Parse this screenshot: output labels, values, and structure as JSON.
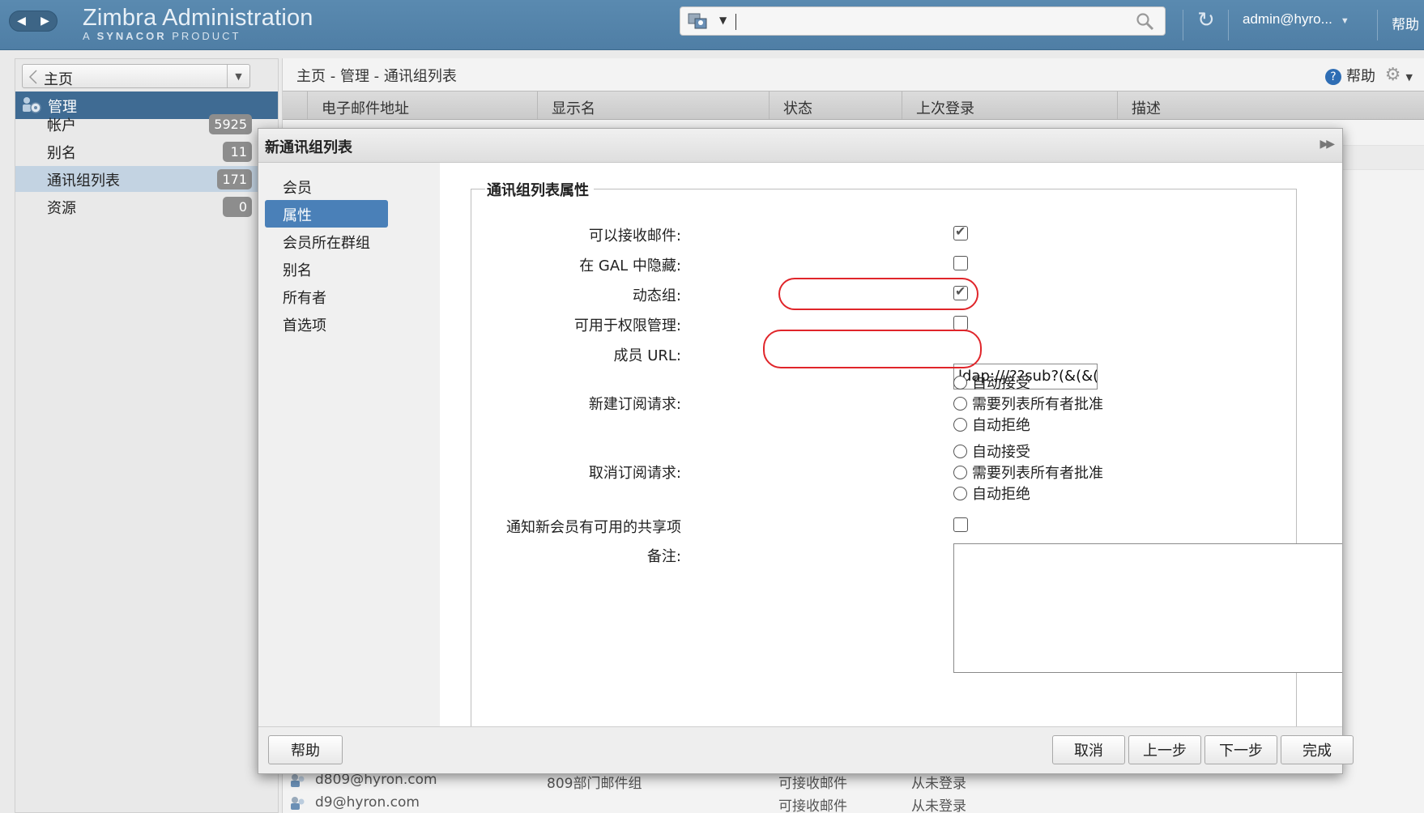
{
  "header": {
    "brand_title": "Zimbra Administration",
    "brand_sub_prefix": "A ",
    "brand_sub_bold": "SYNACOR",
    "brand_sub_suffix": " PRODUCT",
    "search_value": "",
    "user": "admin@hyro...",
    "help": "帮助",
    "icons": [
      "back-arrow-icon",
      "forward-arrow-icon",
      "search-type-icon",
      "search-icon",
      "refresh-icon",
      "chevron-down-icon"
    ]
  },
  "sidebar": {
    "home": "主页",
    "section": "管理",
    "items": [
      {
        "label": "帐户",
        "count": "5925"
      },
      {
        "label": "别名",
        "count": "11"
      },
      {
        "label": "通讯组列表",
        "count": "171"
      },
      {
        "label": "资源",
        "count": "0"
      }
    ],
    "selected_index": 2
  },
  "main": {
    "breadcrumb": "主页 - 管理 - 通讯组列表",
    "help": "帮助",
    "columns": [
      "电子邮件地址",
      "显示名",
      "状态",
      "上次登录",
      "描述"
    ],
    "rows": [
      {
        "email": "d809@hyron.com",
        "name": "809部门邮件组",
        "status": "可接收邮件",
        "last": "从未登录"
      },
      {
        "email": "d9@hyron.com",
        "name": "",
        "status": "可接收邮件",
        "last": "从未登录"
      }
    ]
  },
  "dialog": {
    "title": "新通讯组列表",
    "nav": [
      "会员",
      "属性",
      "会员所在群组",
      "别名",
      "所有者",
      "首选项"
    ],
    "nav_selected": 1,
    "section_title": "通讯组列表属性",
    "fields": {
      "can_receive": {
        "label": "可以接收邮件:",
        "checked": true
      },
      "hide_gal": {
        "label": "在 GAL 中隐藏:",
        "checked": false
      },
      "dynamic": {
        "label": "动态组:",
        "checked": true
      },
      "rights_mgmt": {
        "label": "可用于权限管理:",
        "checked": false
      },
      "member_url": {
        "label": "成员 URL:",
        "value": "ldap:///??sub?(&(&(o"
      },
      "subscribe": {
        "label": "新建订阅请求:",
        "options": [
          "自动接受",
          "需要列表所有者批准",
          "自动拒绝"
        ]
      },
      "unsubscribe": {
        "label": "取消订阅请求:",
        "options": [
          "自动接受",
          "需要列表所有者批准",
          "自动拒绝"
        ]
      },
      "notify_share": {
        "label": "通知新会员有可用的共享项",
        "checked": false
      },
      "notes": {
        "label": "备注:",
        "value": ""
      }
    },
    "buttons": {
      "help": "帮助",
      "cancel": "取消",
      "prev": "上一步",
      "next": "下一步",
      "finish": "完成"
    },
    "highlight_color": "#e0252a",
    "accent": "#4a80b8"
  }
}
